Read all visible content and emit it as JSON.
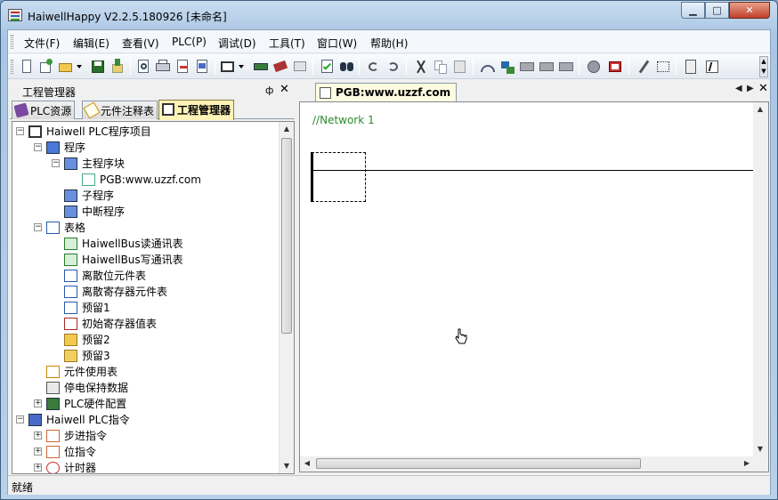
{
  "window": {
    "title": "HaiwellHappy V2.2.5.180926 [未命名]",
    "minimize_glyph": "▁",
    "maximize_glyph": "□",
    "close_glyph": "✕"
  },
  "menubar": {
    "items": [
      "文件(F)",
      "编辑(E)",
      "查看(V)",
      "PLC(P)",
      "调试(D)",
      "工具(T)",
      "窗口(W)",
      "帮助(H)"
    ]
  },
  "toolbar": {
    "icons": [
      "new-file-icon",
      "open-project-icon",
      "open-folder-icon",
      "save-icon",
      "upload-icon",
      "print-preview-icon",
      "print-icon",
      "edit-doc-icon",
      "doc-icon",
      "window-icon",
      "plc-connect-icon",
      "plc-config-icon",
      "monitor-icon",
      "check-icon",
      "find-icon",
      "undo-icon",
      "redo-icon",
      "cut-icon",
      "copy-icon",
      "paste-icon",
      "network-icon",
      "online-icon",
      "download-icon",
      "compare-icon",
      "transfer-icon",
      "stop-icon",
      "run-icon",
      "pen-icon",
      "format-icon",
      "calc-icon",
      "text-icon"
    ]
  },
  "left_pane": {
    "title": "工程管理器",
    "pin_glyph": "ф",
    "close_glyph": "✕",
    "tabs": [
      {
        "label": "PLC资源",
        "icon": "plc-resource-icon"
      },
      {
        "label": "元件注释表",
        "icon": "annotation-icon"
      },
      {
        "label": "工程管理器",
        "icon": "project-manager-icon",
        "active": true
      }
    ],
    "tree": [
      {
        "label": "Haiwell PLC程序项目",
        "level": 0,
        "expander": "−",
        "icon": "project-icon"
      },
      {
        "label": "程序",
        "level": 1,
        "expander": "−",
        "icon": "program-icon"
      },
      {
        "label": "主程序块",
        "level": 2,
        "expander": "−",
        "icon": "block-icon"
      },
      {
        "label": "PGB:www.uzzf.com",
        "level": 3,
        "expander": "",
        "icon": "ladder-icon"
      },
      {
        "label": "子程序",
        "level": 2,
        "expander": "",
        "icon": "block-icon"
      },
      {
        "label": "中断程序",
        "level": 2,
        "expander": "",
        "icon": "block-icon"
      },
      {
        "label": "表格",
        "level": 1,
        "expander": "−",
        "icon": "table-icon"
      },
      {
        "label": "HaiwellBus读通讯表",
        "level": 2,
        "expander": "",
        "icon": "comm-table-icon"
      },
      {
        "label": "HaiwellBus写通讯表",
        "level": 2,
        "expander": "",
        "icon": "comm-table-icon"
      },
      {
        "label": "离散位元件表",
        "level": 2,
        "expander": "",
        "icon": "grid-icon"
      },
      {
        "label": "离散寄存器元件表",
        "level": 2,
        "expander": "",
        "icon": "grid-icon"
      },
      {
        "label": "预留1",
        "level": 2,
        "expander": "",
        "icon": "grid-icon"
      },
      {
        "label": "初始寄存器值表",
        "level": 2,
        "expander": "",
        "icon": "init-table-icon"
      },
      {
        "label": "预留2",
        "level": 2,
        "expander": "",
        "icon": "reserve-icon"
      },
      {
        "label": "预留3",
        "level": 2,
        "expander": "",
        "icon": "folder-icon"
      },
      {
        "label": "元件使用表",
        "level": 1,
        "expander": "",
        "icon": "usage-icon"
      },
      {
        "label": "停电保持数据",
        "level": 1,
        "expander": "",
        "icon": "power-hold-icon"
      },
      {
        "label": "PLC硬件配置",
        "level": 1,
        "expander": "+",
        "icon": "hardware-icon"
      },
      {
        "label": "Haiwell PLC指令",
        "level": 0,
        "expander": "−",
        "icon": "instruction-icon"
      },
      {
        "label": "步进指令",
        "level": 1,
        "expander": "+",
        "icon": "step-icon"
      },
      {
        "label": "位指令",
        "level": 1,
        "expander": "+",
        "icon": "bit-icon"
      },
      {
        "label": "计时器",
        "level": 1,
        "expander": "+",
        "icon": "timer-icon"
      }
    ]
  },
  "editor": {
    "tab_label": "PGB:www.uzzf.com",
    "nav_left": "◀",
    "nav_right": "▶",
    "close_glyph": "✕",
    "network_label": "//Network 1"
  },
  "statusbar": {
    "text": "就绪"
  },
  "colors": {
    "network_label": "#2d8a2d",
    "active_tab": "#fff3b8"
  }
}
